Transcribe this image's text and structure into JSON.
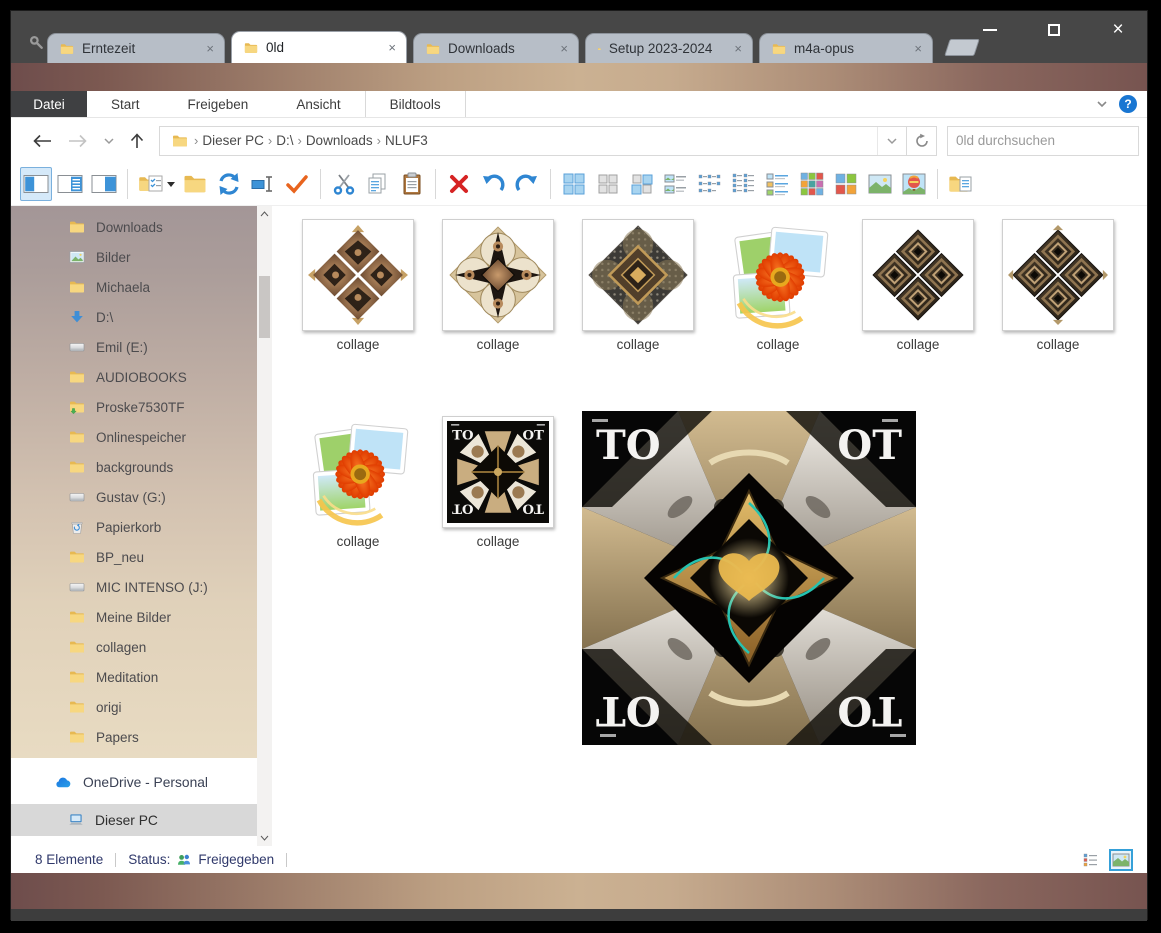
{
  "window": {
    "tab_strip": {
      "tabs": [
        {
          "label": "Erntezeit"
        },
        {
          "label": "0ld"
        },
        {
          "label": "Downloads"
        },
        {
          "label": "Setup 2023-2024"
        },
        {
          "label": "m4a-opus"
        }
      ],
      "active_index": 1,
      "close_glyph": "×"
    },
    "controls": {
      "close_glyph": "×"
    }
  },
  "ribbon": {
    "file_menu": "Datei",
    "tabs": [
      "Start",
      "Freigeben",
      "Ansicht",
      "Bildtools"
    ],
    "help_glyph": "?"
  },
  "address_bar": {
    "breadcrumb": [
      "Dieser PC",
      "D:\\",
      "Downloads",
      "NLUF3"
    ],
    "separator": "›"
  },
  "search": {
    "placeholder": "0ld durchsuchen"
  },
  "sidebar": {
    "items": [
      {
        "label": "Downloads",
        "icon": "folder"
      },
      {
        "label": "Bilder",
        "icon": "picture"
      },
      {
        "label": "Michaela",
        "icon": "folder"
      },
      {
        "label": "D:\\",
        "icon": "down-arrow"
      },
      {
        "label": "Emil (E:)",
        "icon": "drive"
      },
      {
        "label": "AUDIOBOOKS",
        "icon": "folder"
      },
      {
        "label": "Proske7530TF",
        "icon": "folder-download"
      },
      {
        "label": "Onlinespeicher",
        "icon": "folder"
      },
      {
        "label": "backgrounds",
        "icon": "folder"
      },
      {
        "label": "Gustav (G:)",
        "icon": "drive"
      },
      {
        "label": "Papierkorb",
        "icon": "recycle-bin"
      },
      {
        "label": "BP_neu",
        "icon": "folder"
      },
      {
        "label": "MIC INTENSO (J:)",
        "icon": "drive"
      },
      {
        "label": "Meine Bilder",
        "icon": "folder"
      },
      {
        "label": "collagen",
        "icon": "folder"
      },
      {
        "label": "Meditation",
        "icon": "folder"
      },
      {
        "label": "origi",
        "icon": "folder"
      },
      {
        "label": "Papers",
        "icon": "folder"
      }
    ],
    "onedrive_label": "OneDrive - Personal",
    "this_pc_label": "Dieser PC"
  },
  "files": {
    "items": [
      {
        "label": "collage",
        "kind": "kaleido-cross"
      },
      {
        "label": "collage",
        "kind": "kaleido-quatrefoil"
      },
      {
        "label": "collage",
        "kind": "kaleido-dotted"
      },
      {
        "label": "collage",
        "kind": "photo-gallery-icon"
      },
      {
        "label": "collage",
        "kind": "kaleido-diamonds"
      },
      {
        "label": "collage",
        "kind": "kaleido-diamonds-tipped"
      },
      {
        "label": "collage",
        "kind": "photo-gallery-icon"
      },
      {
        "label": "collage",
        "kind": "kaleido-toot"
      }
    ]
  },
  "artwork": {
    "corner_tl": "TO",
    "corner_tr": "OT"
  },
  "status_bar": {
    "count": "8 Elemente",
    "status_label": "Status:",
    "status_value": "Freigegeben"
  },
  "colors": {
    "accent_blue": "#2f86d2",
    "folder_gold": "#f7d780",
    "band_dark": "#6e4d4c",
    "band_light": "#cbb192",
    "delete_red": "#d62323",
    "check_orange": "#e8641e",
    "status_text": "#30396b"
  }
}
